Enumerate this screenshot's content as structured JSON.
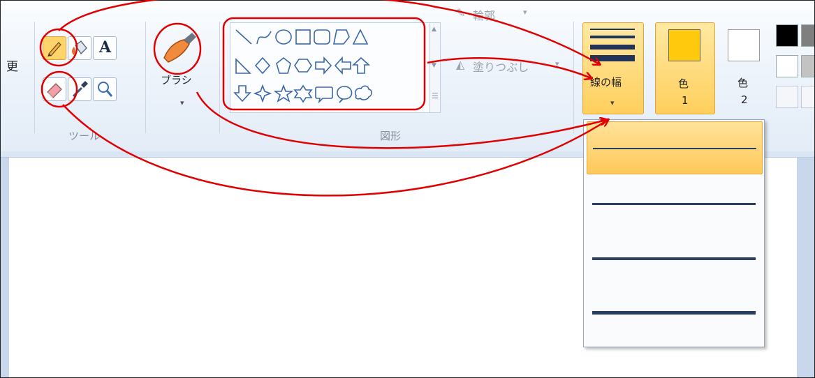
{
  "ribbon": {
    "cut_label": "更",
    "tools": {
      "group_label": "ツール",
      "pencil_icon": "pencil-icon",
      "fill_icon": "paint-bucket-icon",
      "text_icon": "text-tool-icon",
      "text_glyph": "A",
      "eraser_icon": "eraser-icon",
      "picker_icon": "color-picker-icon",
      "magnifier_icon": "magnifier-icon"
    },
    "brush": {
      "label": "ブラシ",
      "arrow": "▾"
    },
    "shapes": {
      "group_label": "図形",
      "outline_label": "輪郭",
      "fill_label": "塗りつぶし",
      "dropdown_arrow": "▾"
    },
    "line_width": {
      "label": "線の幅",
      "arrow": "▾"
    },
    "color1": {
      "label_top": "色",
      "label_num": "1",
      "color": "#ffc90e"
    },
    "color2": {
      "label_top": "色",
      "label_num": "2",
      "color": "#ffffff"
    },
    "palette": [
      "#000000",
      "#7f7f7f",
      "#ffffff",
      "#c3c3c3"
    ]
  },
  "dropdown": {
    "options": [
      {
        "name": "1px",
        "selected": true
      },
      {
        "name": "3px",
        "selected": false
      },
      {
        "name": "5px",
        "selected": false
      },
      {
        "name": "8px",
        "selected": false
      }
    ]
  },
  "annotation_color": "#e00000"
}
